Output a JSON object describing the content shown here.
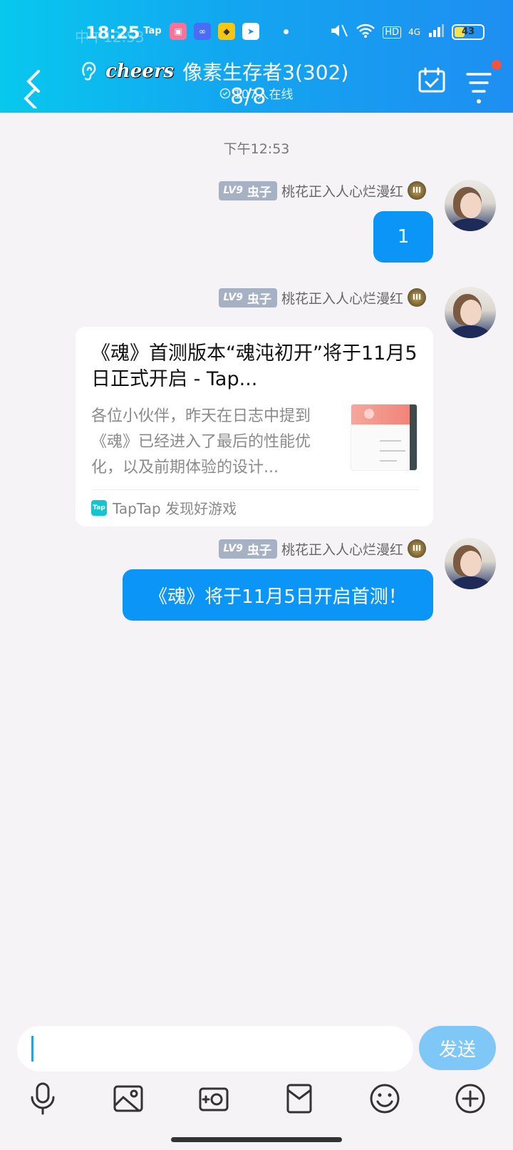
{
  "status_bar": {
    "time": "18:25",
    "ghost_text": "中午12:53",
    "tap_icon": "Tap",
    "bili_icon": "bili",
    "network": "4G",
    "battery": "43",
    "battery_level": 0.43
  },
  "header": {
    "brand": "cheers",
    "group_name": "像素生存者3(302)",
    "online_text": "107人在线",
    "pager": "8/8"
  },
  "chat": {
    "timestamp": "下午12:53",
    "messages": [
      {
        "level": "LV9",
        "title": "虫子",
        "nickname": "桃花正入人心烂漫红",
        "crown": "III",
        "text": "1"
      },
      {
        "level": "LV9",
        "title": "虫子",
        "nickname": "桃花正入人心烂漫红",
        "crown": "III",
        "card": {
          "title": "《魂》首测版本“魂沌初开”将于11月5日正式开启 - Tap...",
          "description": "各位小伙伴，昨天在日志中提到《魂》已经进入了最后的性能优化，以及前期体验的设计...",
          "source_logo": "Tap",
          "source": "TapTap 发现好游戏"
        }
      },
      {
        "level": "LV9",
        "title": "虫子",
        "nickname": "桃花正入人心烂漫红",
        "crown": "III",
        "text": "《魂》将于11月5日开启首测！"
      }
    ]
  },
  "input": {
    "value": "",
    "send_label": "发送"
  },
  "colors": {
    "accent": "#0a95f7",
    "header_start": "#08c8ee",
    "header_end": "#1e8ef2",
    "send_disabled": "#7fc7f7"
  },
  "toolbar_icons": [
    "mic-icon",
    "image-icon",
    "camera-icon",
    "red-packet-icon",
    "emoji-icon",
    "plus-icon"
  ]
}
